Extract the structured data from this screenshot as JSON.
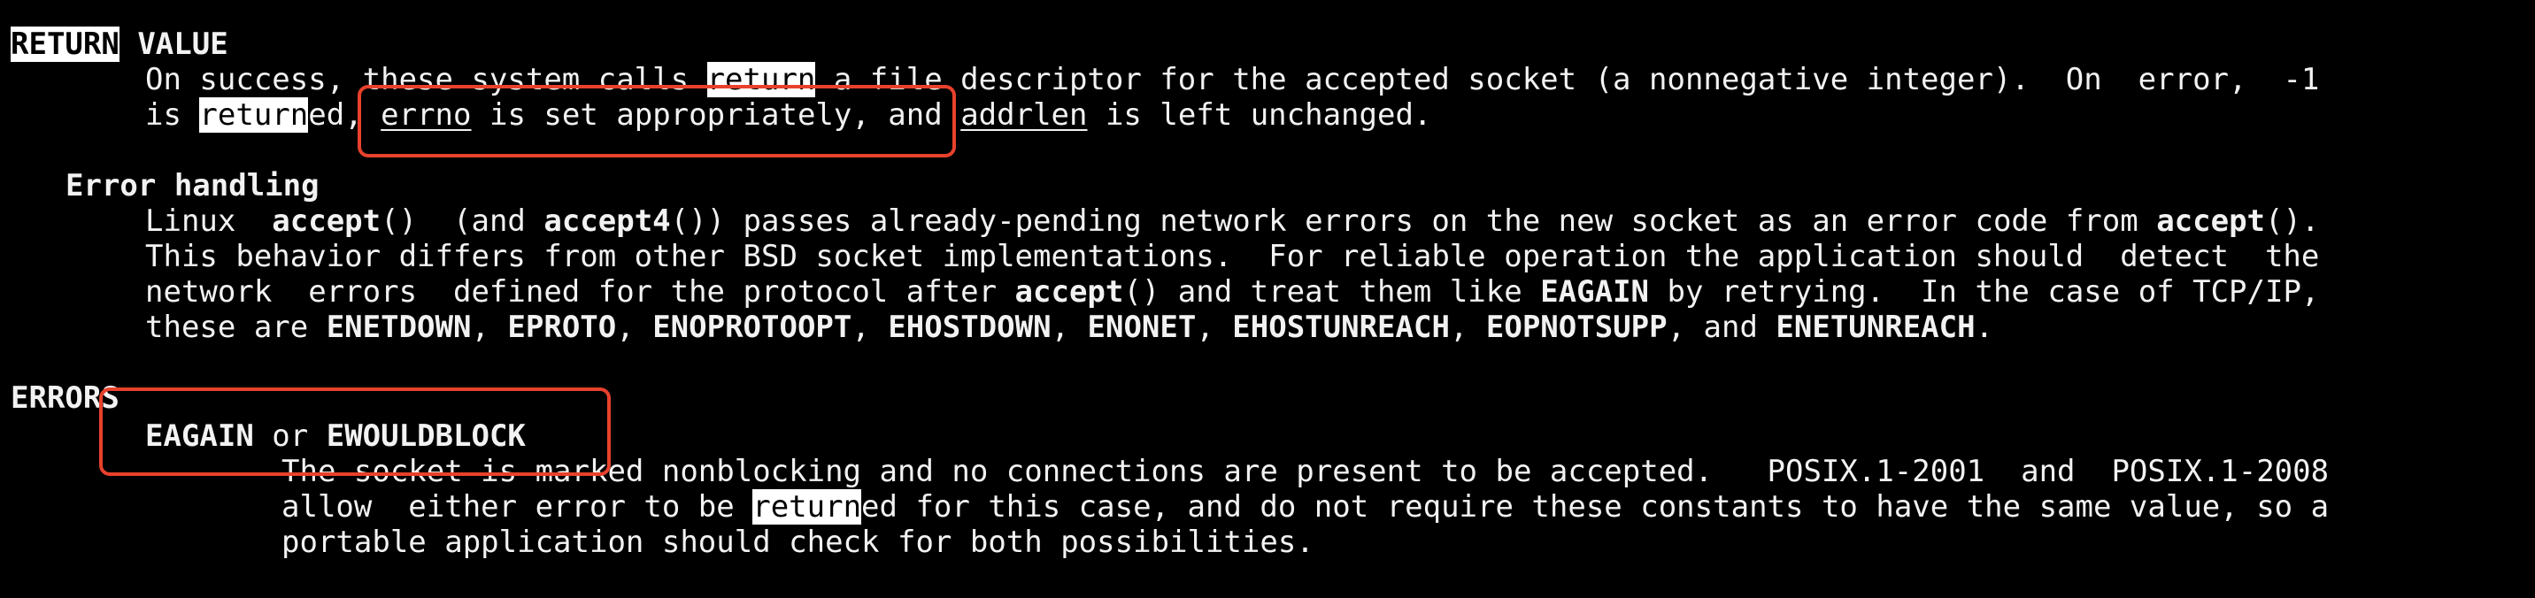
{
  "sections": {
    "return_value": {
      "heading_1": "RETURN",
      "heading_2": "VALUE",
      "line1": {
        "t1": "On success, these system calls ",
        "hl": "return",
        "t2": " a file descriptor for the accepted socket (a nonnegative integer).  On  error,  -1"
      },
      "line2": {
        "t1": "is ",
        "hl": "return",
        "t2": "ed, ",
        "u1": "errno",
        "t3": " is set appropriately, and ",
        "u2": "addrlen",
        "t4": " is left unchanged."
      }
    },
    "error_handling": {
      "heading": "Error handling",
      "line1": {
        "t1": "Linux  ",
        "b1": "accept",
        "t2": "()  (and ",
        "b2": "accept4",
        "t3": "()) passes already-pending network errors on the new socket as an error code from ",
        "b3": "accept",
        "t4": "()."
      },
      "line2": "This behavior differs from other BSD socket implementations.  For reliable operation the application should  detect  the",
      "line3": {
        "t1": "network  errors  defined for the protocol after ",
        "b1": "accept",
        "t2": "() and treat them like ",
        "b2": "EAGAIN",
        "t3": " by retrying.  In the case of TCP/IP,"
      },
      "line4": {
        "t1": "these are ",
        "b1": "ENETDOWN",
        "t2": ", ",
        "b2": "EPROTO",
        "t3": ", ",
        "b3": "ENOPROTOOPT",
        "t4": ", ",
        "b4": "EHOSTDOWN",
        "t5": ", ",
        "b5": "ENONET",
        "t6": ", ",
        "b6": "EHOSTUNREACH",
        "t7": ", ",
        "b7": "EOPNOTSUPP",
        "t8": ", and ",
        "b8": "ENETUNREACH",
        "t9": "."
      }
    },
    "errors": {
      "heading": "ERRORS",
      "item_line": {
        "b1": "EAGAIN",
        "t1": " or ",
        "b2": "EWOULDBLOCK"
      },
      "line1": "The socket is marked nonblocking and no connections are present to be accepted.   POSIX.1-2001  and  POSIX.1-2008",
      "line2": {
        "t1": "allow  either error to be ",
        "hl": "return",
        "t2": "ed for this case, and do not require these constants to have the same value, so a"
      },
      "line3": "portable application should check for both possibilities."
    }
  },
  "colors": {
    "background": "#000000",
    "text": "#f2f2f2",
    "highlight_bg": "#ffffff",
    "annotation": "#e8412c"
  }
}
